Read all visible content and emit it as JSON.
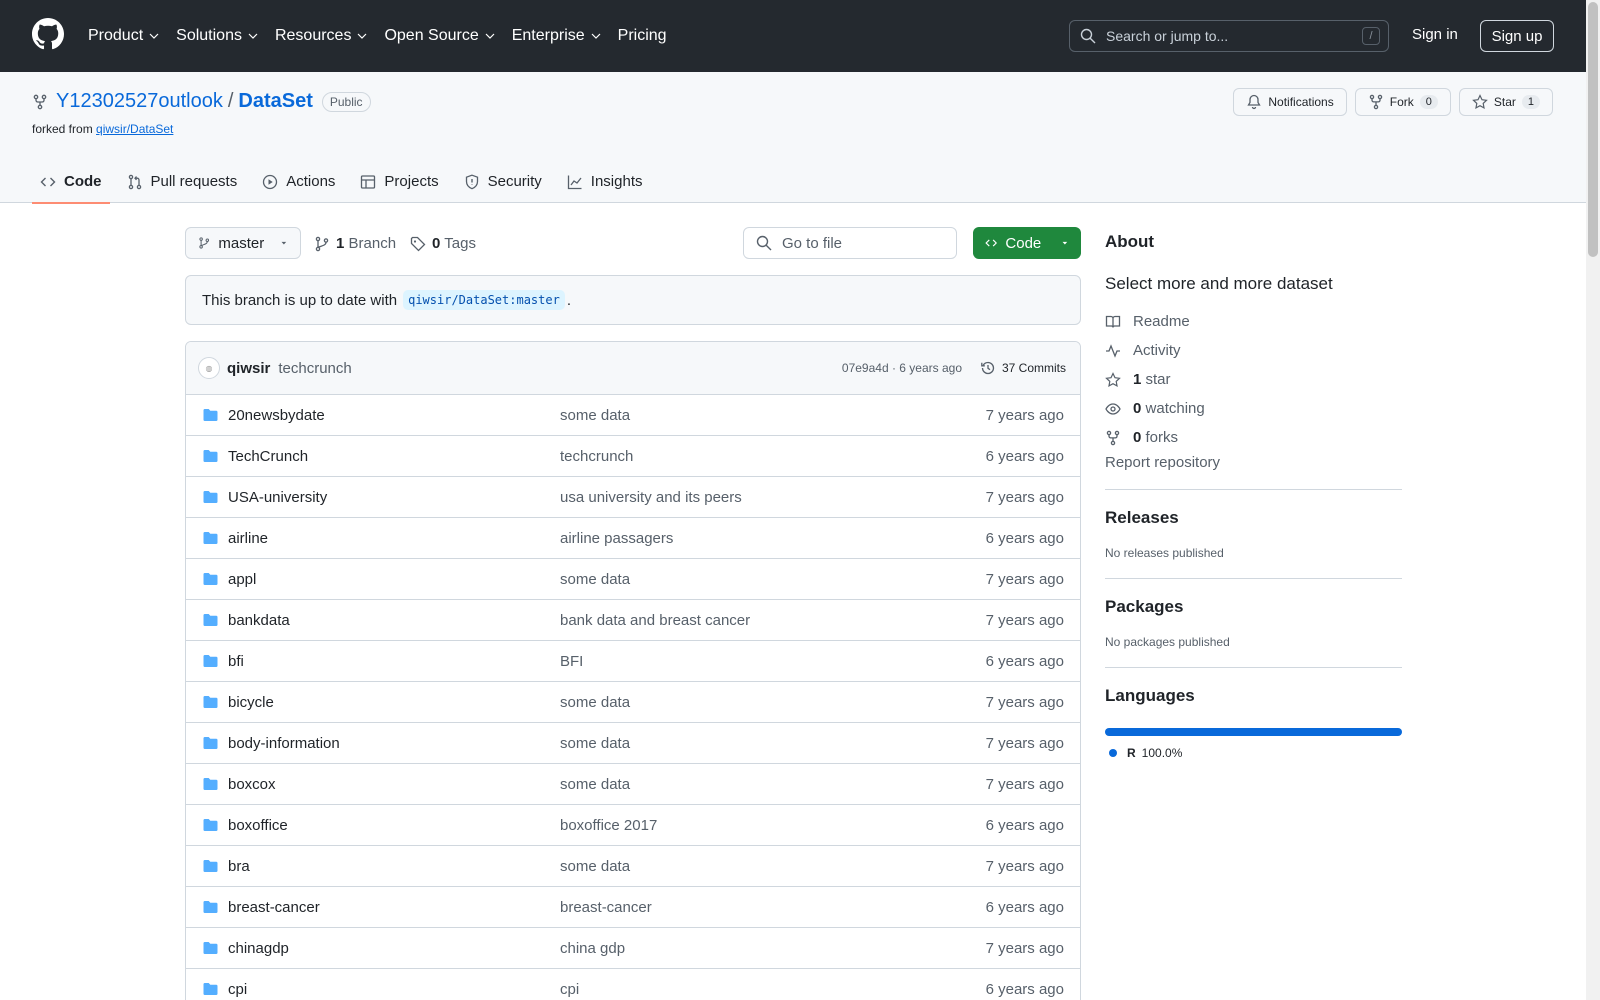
{
  "header": {
    "nav": [
      "Product",
      "Solutions",
      "Resources",
      "Open Source",
      "Enterprise",
      "Pricing"
    ],
    "search_placeholder": "Search or jump to...",
    "search_shortcut": "/",
    "signin": "Sign in",
    "signup": "Sign up"
  },
  "repo": {
    "owner": "Y12302527outlook",
    "separator": "/",
    "name": "DataSet",
    "visibility": "Public",
    "forked_prefix": "forked from",
    "forked_from": "qiwsir/DataSet",
    "notifications_label": "Notifications",
    "fork_label": "Fork",
    "fork_count": "0",
    "star_label": "Star",
    "star_count": "1",
    "tabs": [
      "Code",
      "Pull requests",
      "Actions",
      "Projects",
      "Security",
      "Insights"
    ]
  },
  "toolbar": {
    "branch": "master",
    "branch_count": "1",
    "branch_label": "Branch",
    "tag_count": "0",
    "tag_label": "Tags",
    "goto_placeholder": "Go to file",
    "code_label": "Code"
  },
  "status": {
    "prefix": "This branch is up to date with",
    "ref": "qiwsir/DataSet:master",
    "suffix": "."
  },
  "commit": {
    "author": "qiwsir",
    "message": "techcrunch",
    "meta": "07e9a4d · 6 years ago",
    "commits_label": "37 Commits"
  },
  "files": [
    {
      "name": "20newsbydate",
      "message": "some data",
      "age": "7 years ago"
    },
    {
      "name": "TechCrunch",
      "message": "techcrunch",
      "age": "6 years ago"
    },
    {
      "name": "USA-university",
      "message": "usa university and its peers",
      "age": "7 years ago"
    },
    {
      "name": "airline",
      "message": "airline passagers",
      "age": "6 years ago"
    },
    {
      "name": "appl",
      "message": "some data",
      "age": "7 years ago"
    },
    {
      "name": "bankdata",
      "message": "bank data and breast cancer",
      "age": "7 years ago"
    },
    {
      "name": "bfi",
      "message": "BFI",
      "age": "6 years ago"
    },
    {
      "name": "bicycle",
      "message": "some data",
      "age": "7 years ago"
    },
    {
      "name": "body-information",
      "message": "some data",
      "age": "7 years ago"
    },
    {
      "name": "boxcox",
      "message": "some data",
      "age": "7 years ago"
    },
    {
      "name": "boxoffice",
      "message": "boxoffice 2017",
      "age": "6 years ago"
    },
    {
      "name": "bra",
      "message": "some data",
      "age": "7 years ago"
    },
    {
      "name": "breast-cancer",
      "message": "breast-cancer",
      "age": "6 years ago"
    },
    {
      "name": "chinagdp",
      "message": "china gdp",
      "age": "7 years ago"
    },
    {
      "name": "cpi",
      "message": "cpi",
      "age": "6 years ago"
    }
  ],
  "sidebar": {
    "about_title": "About",
    "description": "Select more and more dataset",
    "readme": "Readme",
    "activity": "Activity",
    "stars_count": "1",
    "stars_label": "star",
    "watching_count": "0",
    "watching_label": "watching",
    "forks_count": "0",
    "forks_label": "forks",
    "report": "Report repository",
    "releases_title": "Releases",
    "releases_empty": "No releases published",
    "packages_title": "Packages",
    "packages_empty": "No packages published",
    "languages_title": "Languages",
    "language_name": "R",
    "language_percent": "100.0%",
    "language_share": 1.0,
    "language_color": "#0969da"
  }
}
